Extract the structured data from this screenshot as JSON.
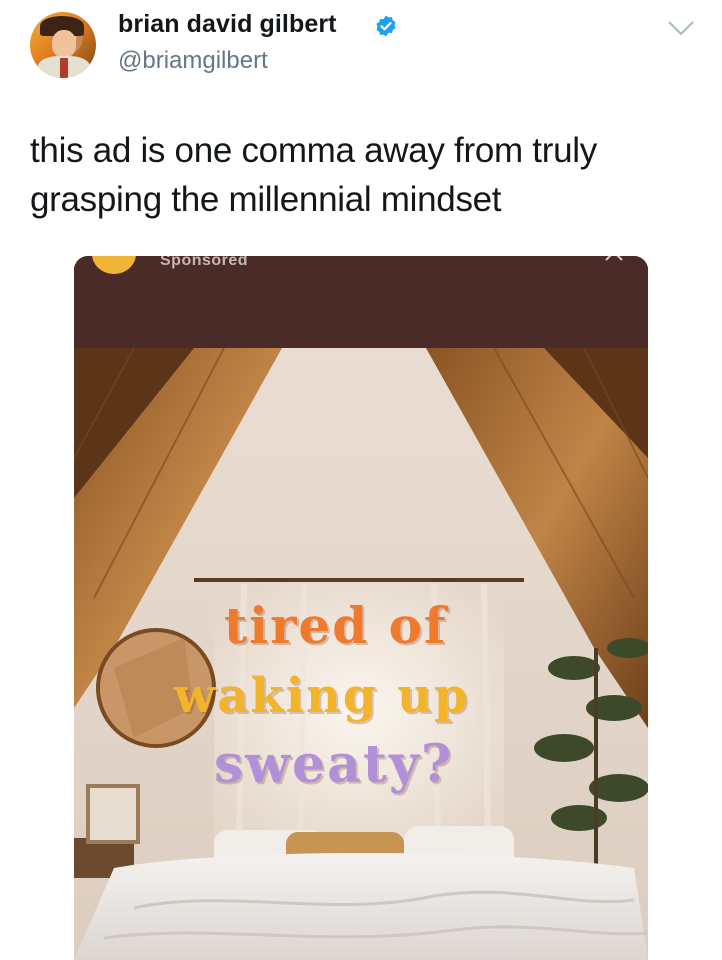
{
  "tweet": {
    "author_name": "brian david gilbert",
    "handle": "@briamgilbert",
    "verified": true,
    "text_line1": "this ad is one comma away from truly",
    "text_line2": "grasping the millennial mindset"
  },
  "icons": {
    "verified": "verified-badge-icon",
    "menu": "chevron-down-icon"
  },
  "ad": {
    "sponsored_label": "Sponsored",
    "headline_line1": "tired of",
    "headline_line2": "waking up",
    "headline_line3": "sweaty?"
  },
  "colors": {
    "verified_blue": "#1da1f2",
    "handle_gray": "#657786",
    "ad_orange": "#ef7a2e",
    "ad_yellow": "#f2b42a",
    "ad_lavender": "#b290d8"
  }
}
